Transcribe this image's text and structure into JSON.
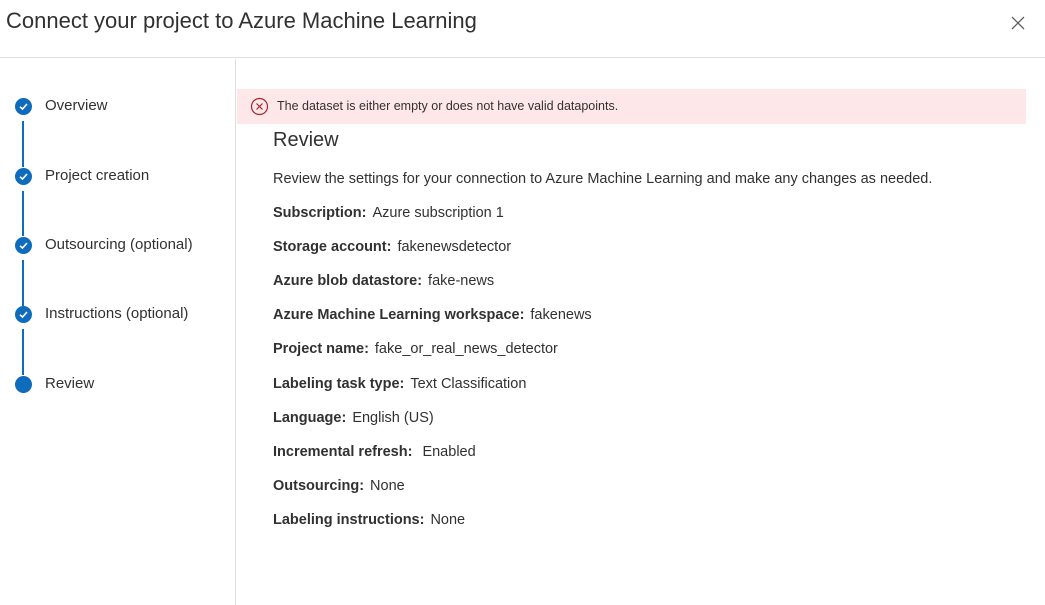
{
  "dialog": {
    "title": "Connect your project to Azure Machine Learning"
  },
  "steps": [
    {
      "label": "Overview",
      "state": "completed"
    },
    {
      "label": "Project creation",
      "state": "completed"
    },
    {
      "label": "Outsourcing (optional)",
      "state": "completed"
    },
    {
      "label": "Instructions (optional)",
      "state": "completed"
    },
    {
      "label": "Review",
      "state": "current"
    }
  ],
  "error": {
    "message": "The dataset is either empty or does not have valid datapoints."
  },
  "review": {
    "title": "Review",
    "description": "Review the settings for your connection to Azure Machine Learning and make any changes as needed.",
    "fields": [
      {
        "label": "Subscription:",
        "value": "Azure subscription 1"
      },
      {
        "label": "Storage account:",
        "value": "fakenewsdetector"
      },
      {
        "label": "Azure blob datastore:",
        "value": "fake-news"
      },
      {
        "label": "Azure Machine Learning workspace:",
        "value": "fakenews"
      },
      {
        "label": "Project name:",
        "value": "fake_or_real_news_detector"
      },
      {
        "label": "Labeling task type:",
        "value": "Text Classification"
      },
      {
        "label": "Language:",
        "value": "English (US)"
      },
      {
        "label": "Incremental refresh:",
        "value": " Enabled"
      },
      {
        "label": "Outsourcing:",
        "value": "None"
      },
      {
        "label": "Labeling instructions:",
        "value": "None"
      }
    ]
  },
  "colors": {
    "accent": "#0f6cbd",
    "error_bg": "#fde7e9",
    "error_icon": "#a4262c"
  }
}
